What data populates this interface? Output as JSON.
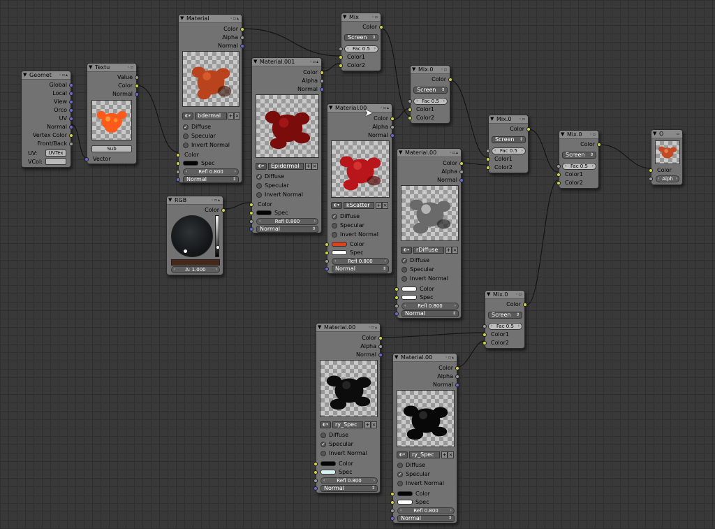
{
  "nodes": {
    "geometry": {
      "title": "Geomet",
      "outputs": [
        "Global",
        "Local",
        "View",
        "Orco",
        "UV",
        "Normal",
        "Vertex Color",
        "Front/Back"
      ],
      "uv_label": "UV:",
      "uv_value": "UVTex",
      "vcol_label": "VCol:",
      "vcol_value": ""
    },
    "texture": {
      "title": "Textu",
      "outputs": [
        "Value",
        "Color",
        "Normal"
      ],
      "tex_name": "Sub",
      "input": "Vector"
    },
    "material_main": {
      "title": "Material",
      "outputs": [
        "Color",
        "Alpha",
        "Normal"
      ],
      "mat_name": "bdermal",
      "checks": [
        "Diffuse",
        "Specular",
        "Invert Normal"
      ],
      "inputs": [
        "Color",
        "Spec"
      ],
      "refl": "Refl 0.800",
      "normal": "Normal"
    },
    "rgb": {
      "title": "RGB",
      "output": "Color",
      "alpha": "A: 1.000"
    },
    "material_001": {
      "title": "Material.001",
      "outputs": [
        "Color",
        "Alpha",
        "Normal"
      ],
      "mat_name": "Epidermal",
      "checks": [
        "Diffuse",
        "Specular",
        "Invert Normal"
      ],
      "inputs": [
        "Color",
        "Spec"
      ],
      "refl": "Refl 0.800",
      "normal": "Normal"
    },
    "mix_top": {
      "title": "Mix",
      "output": "Color",
      "mode": "Screen",
      "fac": "Fac 0.5",
      "inputs": [
        "Color1",
        "Color2"
      ]
    },
    "material_scatter": {
      "title": "Material.00",
      "outputs": [
        "Color",
        "Alpha",
        "Normal"
      ],
      "mat_name": "kScatter",
      "checks": [
        "Diffuse",
        "Specular",
        "Invert Normal"
      ],
      "inputs": [
        "Color",
        "Spec"
      ],
      "refl": "Refl 0.800",
      "normal": "Normal"
    },
    "mix_2": {
      "title": "Mix.0",
      "output": "Color",
      "mode": "Screen",
      "fac": "Fac 0.5",
      "inputs": [
        "Color1",
        "Color2"
      ]
    },
    "material_diffuse": {
      "title": "Material.00",
      "outputs": [
        "Color",
        "Alpha",
        "Normal"
      ],
      "mat_name": "rDiffuse",
      "checks": [
        "Diffuse",
        "Specular",
        "Invert Normal"
      ],
      "inputs": [
        "Color",
        "Spec"
      ],
      "refl": "Refl 0.800",
      "normal": "Normal"
    },
    "mix_3": {
      "title": "Mix.0",
      "output": "Color",
      "mode": "Screen",
      "fac": "Fac 0.5",
      "inputs": [
        "Color1",
        "Color2"
      ]
    },
    "mix_4": {
      "title": "Mix.0",
      "output": "Color",
      "mode": "Screen",
      "fac": "Fac 0.5",
      "inputs": [
        "Color1",
        "Color2"
      ]
    },
    "output": {
      "title": "O",
      "input": "Color",
      "alpha": "Alph"
    },
    "mix_5": {
      "title": "Mix.0",
      "output": "Color",
      "mode": "Screen",
      "fac": "Fac 0.5",
      "inputs": [
        "Color1",
        "Color2"
      ]
    },
    "material_spec1": {
      "title": "Material.00",
      "outputs": [
        "Color",
        "Alpha",
        "Normal"
      ],
      "mat_name": "ry_Spec",
      "checks": [
        "Diffuse",
        "Specular",
        "Invert Normal"
      ],
      "inputs": [
        "Color",
        "Spec"
      ],
      "refl": "Refl 0.800",
      "normal": "Normal"
    },
    "material_spec2": {
      "title": "Material.00",
      "outputs": [
        "Color",
        "Alpha",
        "Normal"
      ],
      "mat_name": "ry_Spec",
      "checks": [
        "Diffuse",
        "Specular",
        "Invert Normal"
      ],
      "inputs": [
        "Color",
        "Spec"
      ],
      "refl": "Refl 0.800",
      "normal": "Normal"
    }
  },
  "colors": {
    "socket_color": "#d2d24a",
    "socket_value": "#9a9a9a",
    "socket_vector": "#6a6ad2",
    "wire": "#111111"
  }
}
